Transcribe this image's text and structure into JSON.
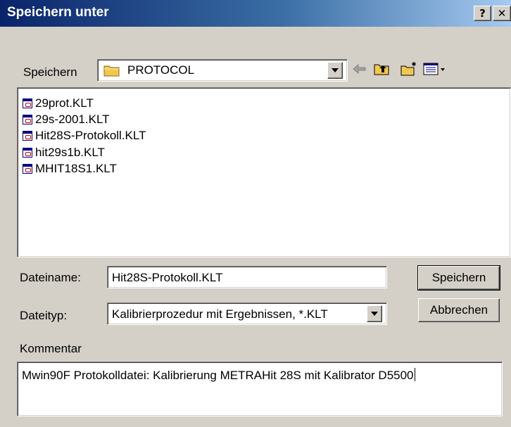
{
  "window": {
    "title": "Speichern unter",
    "help_label": "?",
    "close_label": "✕"
  },
  "location": {
    "label": "Speichern",
    "folder": "PROTOCOL"
  },
  "toolbar": {
    "icons": [
      "back-arrow-icon",
      "up-folder-icon",
      "new-folder-icon",
      "view-menu-icon"
    ]
  },
  "files": [
    {
      "name": "29prot.KLT"
    },
    {
      "name": "29s-2001.KLT"
    },
    {
      "name": "Hit28S-Protokoll.KLT"
    },
    {
      "name": "hit29s1b.KLT"
    },
    {
      "name": "MHIT18S1.KLT"
    }
  ],
  "filename": {
    "label": "Dateiname:",
    "value": "Hit28S-Protokoll.KLT"
  },
  "filetype": {
    "label": "Dateityp:",
    "value": "Kalibrierprozedur mit Ergebnissen, *.KLT"
  },
  "comment": {
    "label": "Kommentar",
    "value": "Mwin90F Protokolldatei: Kalibrierung METRAHit 28S mit Kalibrator D5500"
  },
  "buttons": {
    "save": "Speichern",
    "cancel": "Abbrechen"
  },
  "colors": {
    "title_bar_start": "#0a246a",
    "title_bar_end": "#a6caf0",
    "dialog_bg": "#d4d0c8",
    "folder_yellow": "#f0c850",
    "back_arrow": "#a0a0a0"
  }
}
